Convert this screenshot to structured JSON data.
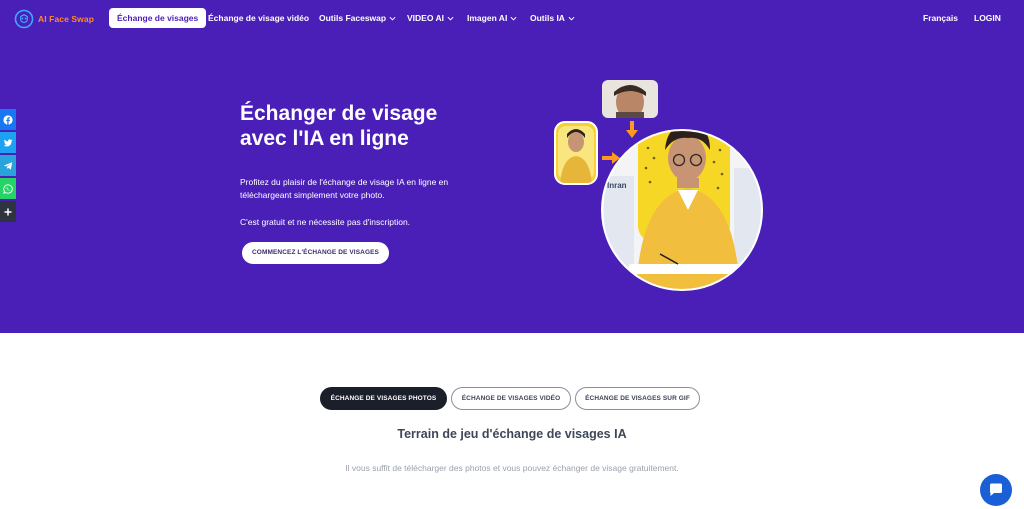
{
  "brand": {
    "logo_text": "AI Face Swap"
  },
  "nav": {
    "items": [
      {
        "label": "Échange de visages"
      },
      {
        "label": "Échange de visage vidéo"
      },
      {
        "label": "Outils Faceswap"
      },
      {
        "label": "VIDEO AI"
      },
      {
        "label": "Imagen AI"
      },
      {
        "label": "Outils IA"
      }
    ],
    "language": "Français",
    "login": "LOGIN"
  },
  "hero": {
    "title": "Échanger de visage avec l'IA en ligne",
    "paragraph1": "Profitez du plaisir de l'échange de visage IA en ligne en téléchargeant simplement votre photo.",
    "paragraph2": "C'est gratuit et ne nécessite pas d'inscription.",
    "cta": "COMMENCEZ L'ÉCHANGE DE VISAGES",
    "illustration_text": "Inran"
  },
  "share": {
    "buttons": [
      {
        "icon": "facebook-icon",
        "color": "#1877f2"
      },
      {
        "icon": "twitter-icon",
        "color": "#1da1f2"
      },
      {
        "icon": "telegram-icon",
        "color": "#2aa3dc"
      },
      {
        "icon": "whatsapp-icon",
        "color": "#25d366"
      },
      {
        "icon": "plus-icon",
        "color": "#2d3440"
      }
    ]
  },
  "tabs": [
    {
      "label": "ÉCHANGE DE VISAGES PHOTOS",
      "active": true
    },
    {
      "label": "ÉCHANGE DE VISAGES VIDÉO",
      "active": false
    },
    {
      "label": "ÉCHANGE DE VISAGES SUR GIF",
      "active": false
    }
  ],
  "playground": {
    "title": "Terrain de jeu d'échange de visages IA",
    "description": "Il vous suffit de télécharger des photos et vous pouvez échanger de visage gratuitement."
  },
  "colors": {
    "hero_bg": "#4a1fb8",
    "brand_orange": "#ff8a2a",
    "chat_blue": "#1a5fd6"
  }
}
